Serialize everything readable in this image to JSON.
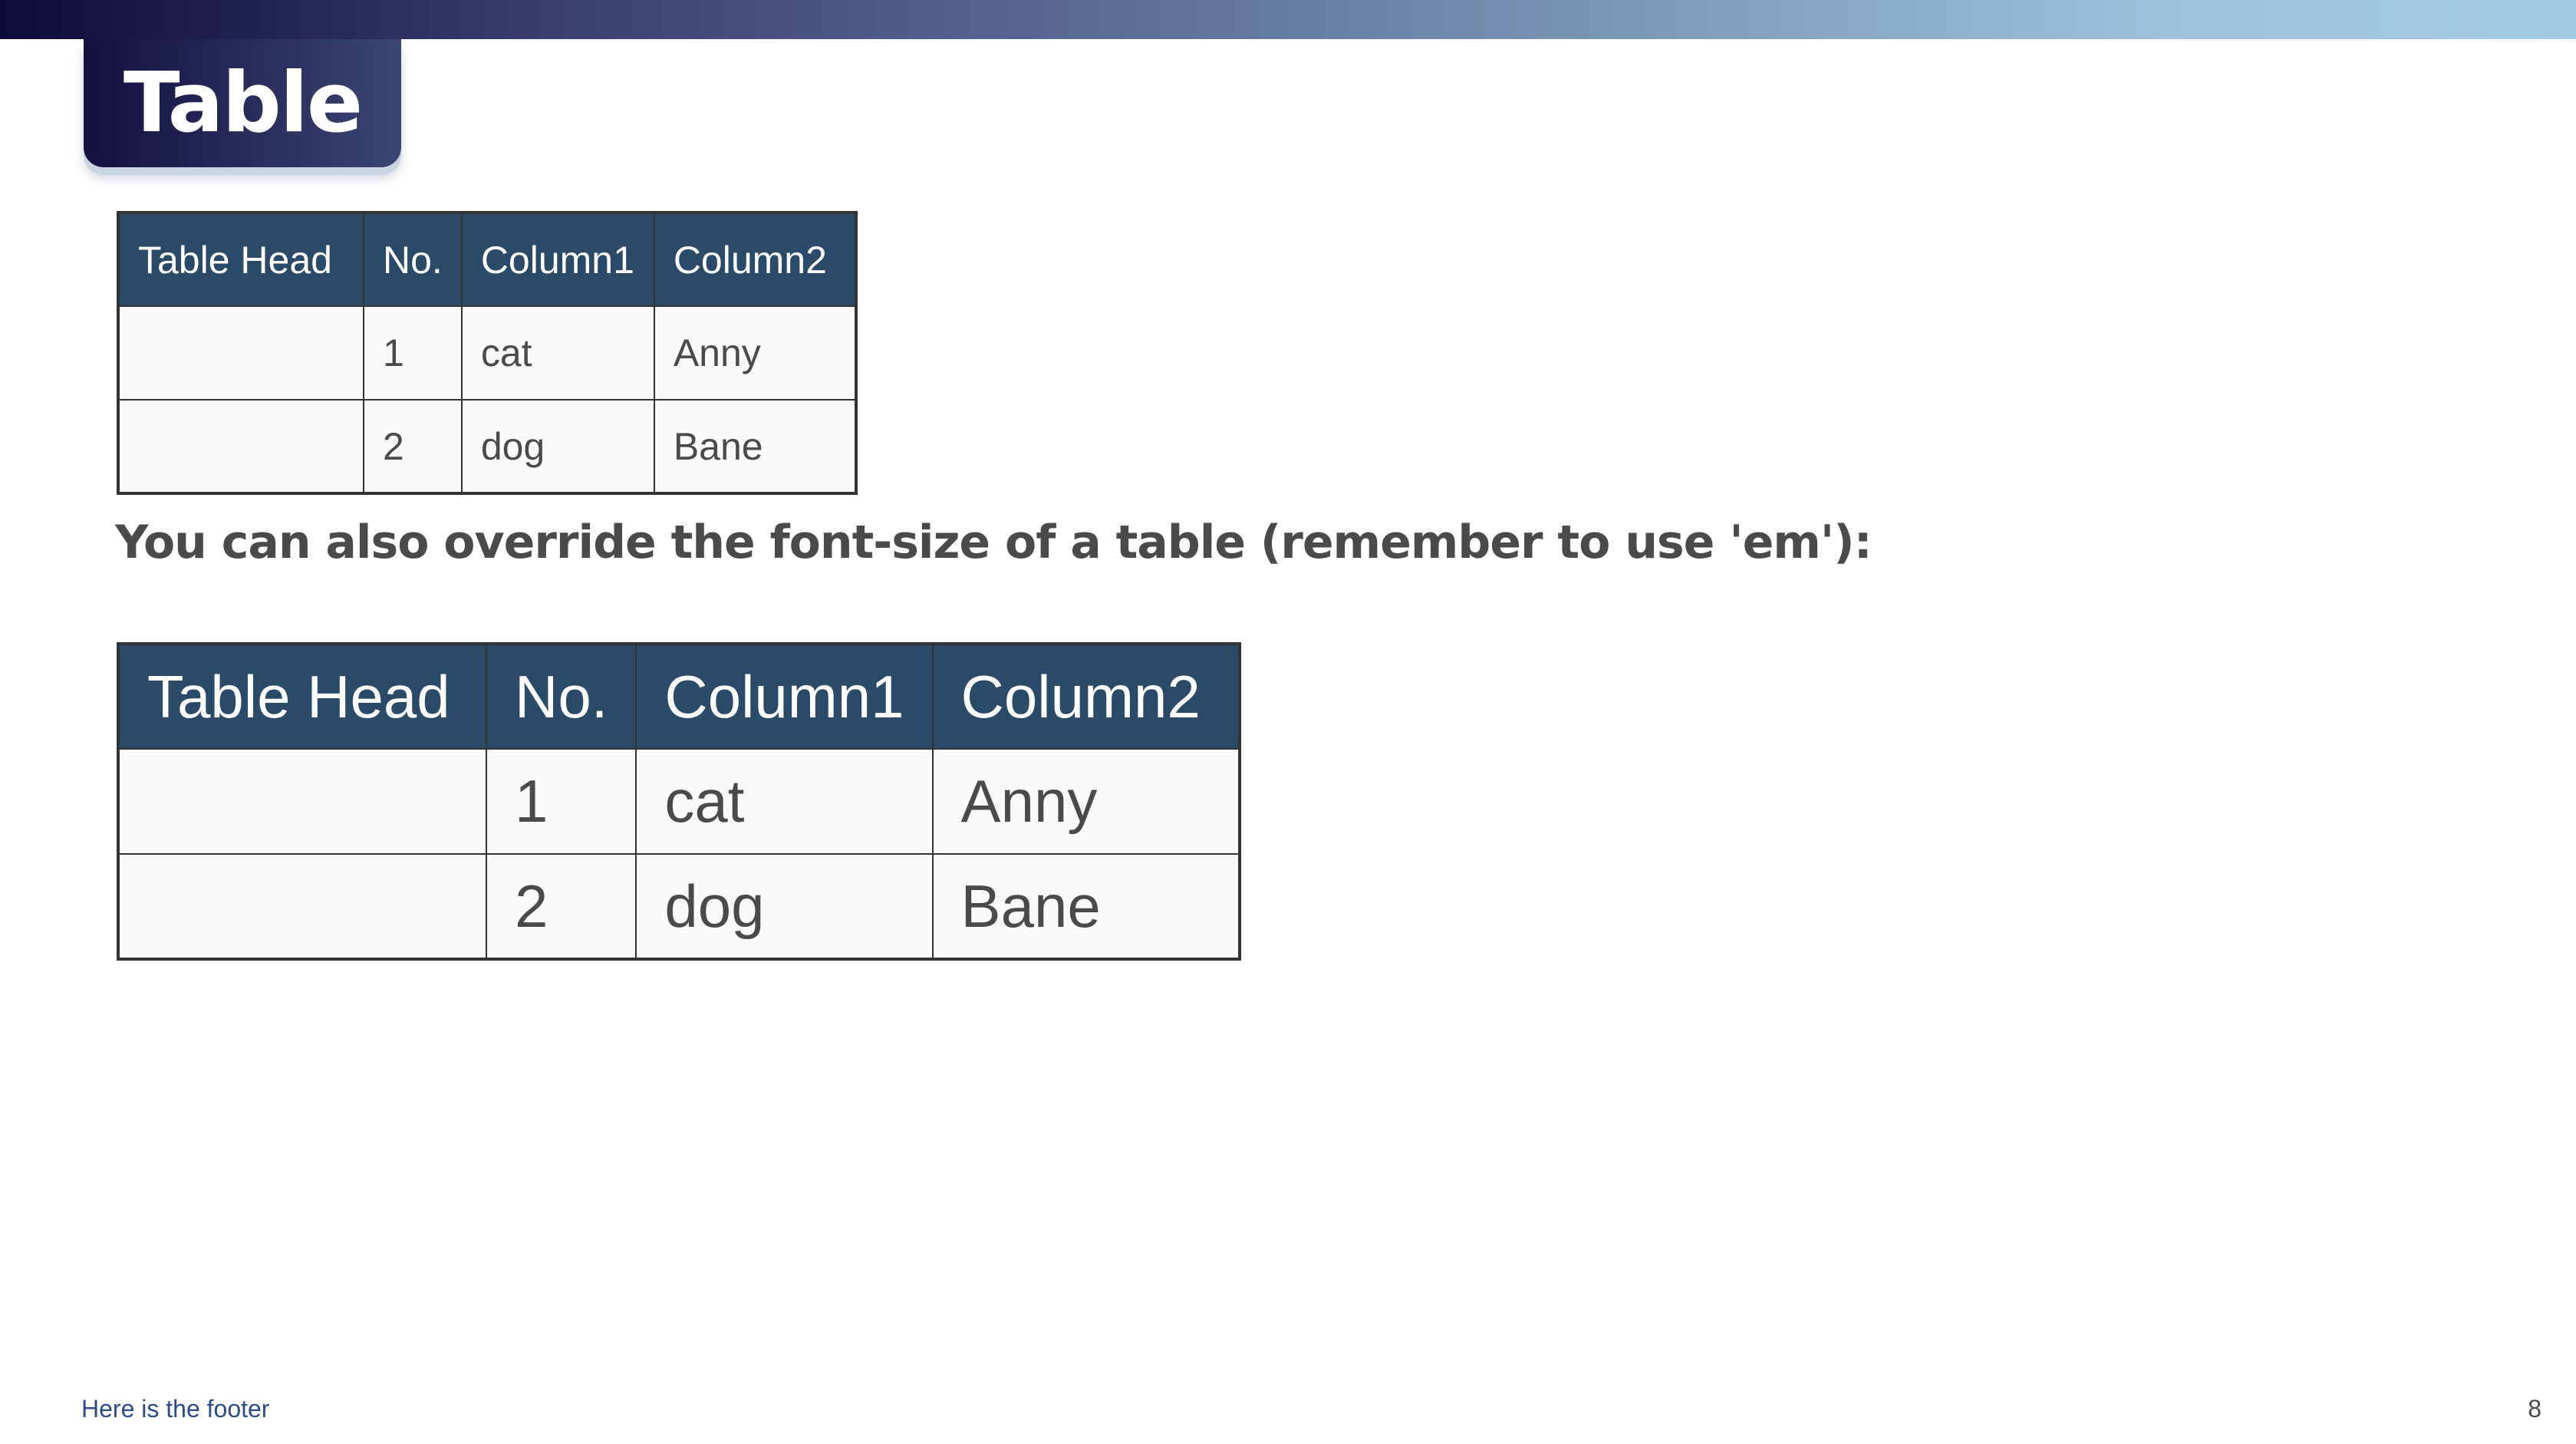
{
  "slide": {
    "title": "Table",
    "note": "You can also override the font-size of a table (remember to use 'em'):",
    "footer": "Here is the footer",
    "page_number": "8"
  },
  "table_small": {
    "headers": [
      "Table Head",
      "No.",
      "Column1",
      "Column2"
    ],
    "rows": [
      [
        "",
        "1",
        "cat",
        "Anny"
      ],
      [
        "",
        "2",
        "dog",
        "Bane"
      ]
    ]
  },
  "table_large": {
    "headers": [
      "Table Head",
      "No.",
      "Column1",
      "Column2"
    ],
    "rows": [
      [
        "",
        "1",
        "cat",
        "Anny"
      ],
      [
        "",
        "2",
        "dog",
        "Bane"
      ]
    ]
  },
  "colors": {
    "header_bg": "#2b4a68",
    "title_tab_start": "#141040",
    "title_tab_end": "#3a4673",
    "top_bar_start": "#0e0b38",
    "top_bar_end": "#a3cbe0",
    "footer_text": "#2d4a8a",
    "body_text": "#4a4a4a"
  }
}
